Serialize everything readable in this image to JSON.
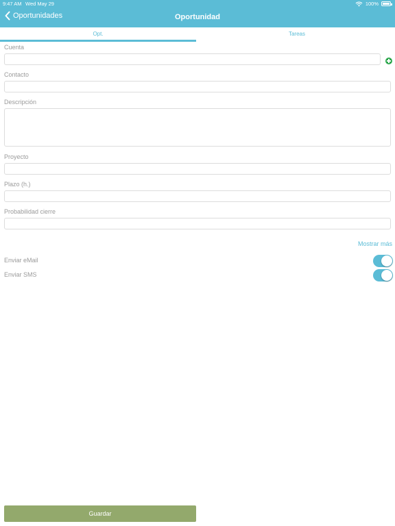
{
  "status_bar": {
    "time": "9:47 AM",
    "date": "Wed May 29",
    "battery": "100%"
  },
  "nav": {
    "back_label": "Oportunidades",
    "title": "Oportunidad"
  },
  "tabs": [
    {
      "label": "Opt.",
      "active": true
    },
    {
      "label": "Tareas",
      "active": false
    }
  ],
  "form": {
    "cuenta": {
      "label": "Cuenta",
      "value": ""
    },
    "contacto": {
      "label": "Contacto",
      "value": ""
    },
    "descripcion": {
      "label": "Descripción",
      "value": ""
    },
    "proyecto": {
      "label": "Proyecto",
      "value": ""
    },
    "plazo": {
      "label": "Plazo (h.)",
      "value": ""
    },
    "probabilidad": {
      "label": "Probabilidad cierre",
      "value": ""
    }
  },
  "show_more": "Mostrar más",
  "switches": [
    {
      "label": "Enviar eMail",
      "on": true
    },
    {
      "label": "Enviar SMS",
      "on": true
    }
  ],
  "save_label": "Guardar",
  "colors": {
    "accent": "#5bbcd6",
    "save": "#93a96c",
    "add": "#2fa84f"
  }
}
